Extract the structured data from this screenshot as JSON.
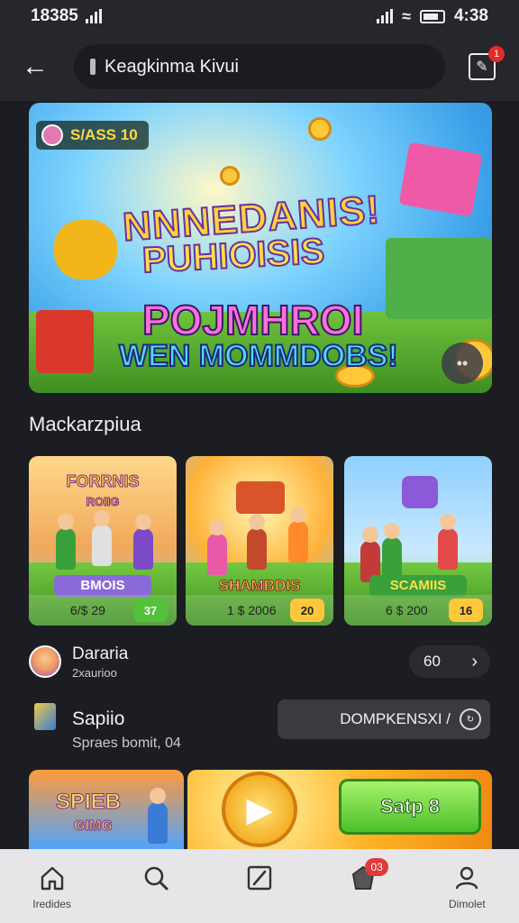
{
  "status": {
    "time": "18385",
    "clock": "4:38"
  },
  "header": {
    "search_text": "Keagkinma Kivui",
    "notification_count": "1"
  },
  "hero": {
    "badge": "S/ASS 10",
    "title_line1": "NNNEDANIS!",
    "title_line2": "PUHIOISIS",
    "title_line3": "POJMHROI",
    "title_line4": "WEN MOMMDOBS!"
  },
  "section": {
    "title": "Mackarzpiua"
  },
  "cards": [
    {
      "title": "FORRNIS",
      "subtitle": "ROIIG",
      "label": "BMOIS",
      "price": "6/$ 29",
      "button": "37",
      "accent": "#52c23a"
    },
    {
      "title": "",
      "subtitle": "",
      "label": "SHAMBDIS",
      "price": "1 $ 2006",
      "button": "20",
      "accent": "#ffc83a"
    },
    {
      "title": "",
      "subtitle": "",
      "label": "SCAMIIS",
      "price": "6 $ 200",
      "button": "16",
      "accent": "#ffc83a"
    }
  ],
  "user_row": {
    "name": "Dararia",
    "subtitle": "2xaurioo",
    "go_label": "60"
  },
  "file_row": {
    "title": "Sapiio",
    "subtitle": "Spraes bomit, 04",
    "button_label": "DOMPKENSXI /"
  },
  "promo": {
    "left_title": "SPIEB",
    "left_subtitle": "GIMG",
    "start_label": "Satp 8"
  },
  "nav": [
    {
      "label": "Iredides",
      "icon": "home-icon",
      "badge": ""
    },
    {
      "label": "",
      "icon": "search-icon",
      "badge": ""
    },
    {
      "label": "",
      "icon": "edit-icon",
      "badge": ""
    },
    {
      "label": "",
      "icon": "bag-icon",
      "badge": "03"
    },
    {
      "label": "Dimolet",
      "icon": "profile-icon",
      "badge": ""
    }
  ]
}
